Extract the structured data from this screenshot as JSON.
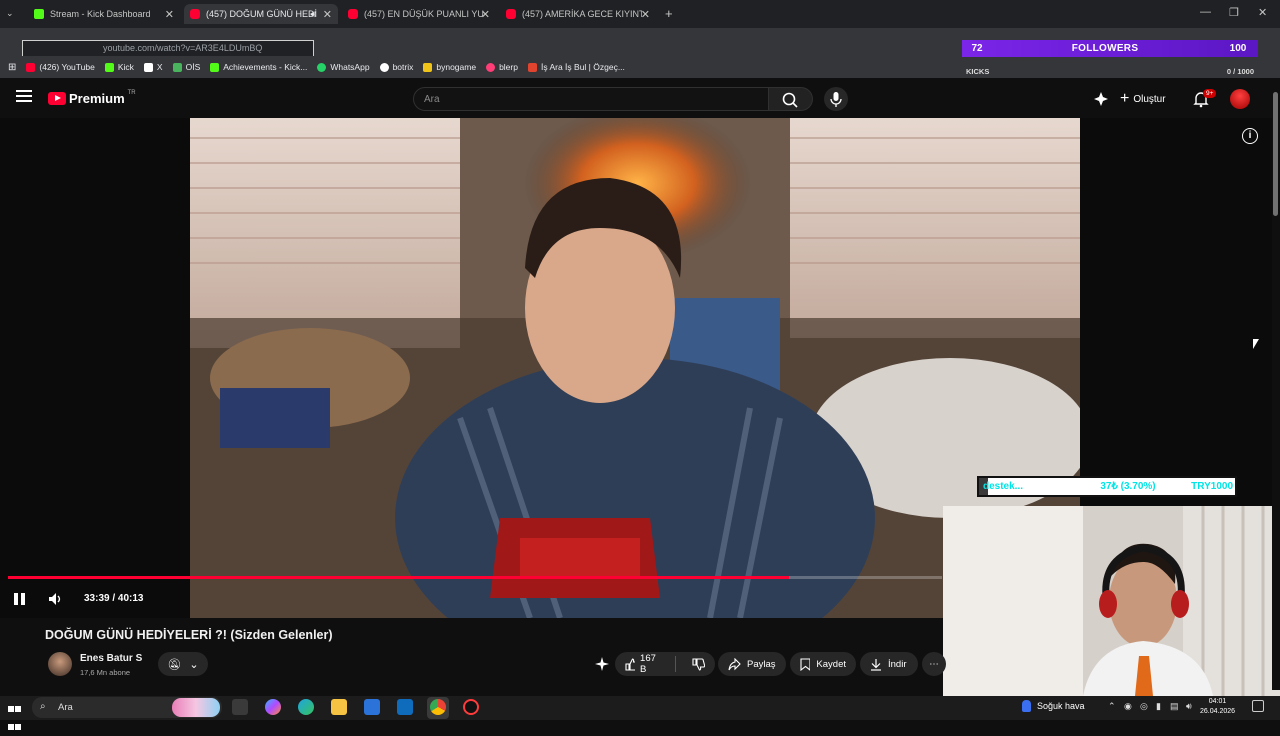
{
  "browser": {
    "tabs": [
      {
        "label": "Stream - Kick Dashboard",
        "favicon": "kick-icon",
        "active": false
      },
      {
        "label": "(457) DOĞUM GÜNÜ HEDİ",
        "favicon": "youtube-icon",
        "active": true
      },
      {
        "label": "(457) EN DÜŞÜK PUANLI YURT",
        "favicon": "youtube-icon",
        "active": false
      },
      {
        "label": "(457) AMERİKA GECE KIYINTISI",
        "favicon": "youtube-icon",
        "active": false
      }
    ],
    "address": "youtube.com/watch?v=AR3E4LDUmBQ",
    "bookmarks": [
      {
        "label": "(426) YouTube",
        "color": "#ff0033"
      },
      {
        "label": "Kick",
        "color": "#53fc18"
      },
      {
        "label": "X",
        "color": "#ffffff"
      },
      {
        "label": "OİS",
        "color": "#49b35d"
      },
      {
        "label": "Achievements - Kick...",
        "color": "#53fc18"
      },
      {
        "label": "WhatsApp",
        "color": "#25d366"
      },
      {
        "label": "botrix",
        "color": "#ffffff"
      },
      {
        "label": "bynogame",
        "color": "#f0c419"
      },
      {
        "label": "blerp",
        "color": "#ff3d77"
      },
      {
        "label": "İş Ara İş Bul | Özgeç...",
        "color": "#e0442f"
      }
    ]
  },
  "overlay": {
    "followers_count": "72",
    "followers_label": "FOLLOWERS",
    "followers_goal": "100",
    "kicks_label": "KICKS",
    "kicks_progress": "0 / 1000",
    "donation_label": "destek...",
    "donation_progress": "37₺ (3.70%)",
    "donation_goal": "TRY1000",
    "donation_fraction": 0.037
  },
  "youtube": {
    "logo_text": "Premium",
    "logo_country": "TR",
    "search_placeholder": "Ara",
    "create_label": "Oluştur",
    "notification_badge": "9+"
  },
  "player": {
    "current_time": "33:39",
    "duration": "40:13",
    "progress_fraction": 0.836,
    "time_display": "33:39 / 40:13"
  },
  "video": {
    "title": "DOĞUM GÜNÜ HEDİYELERİ ?! (Sizden Gelenler)",
    "channel_name": "Enes Batur S",
    "subscribers": "17,6 Mn abone",
    "likes": "167 B",
    "share_label": "Paylaş",
    "save_label": "Kaydet",
    "download_label": "İndir"
  },
  "taskbar": {
    "search_label": "Ara",
    "weather": "Soğuk hava",
    "time": "04:01",
    "date": "26.04.2026"
  },
  "colors": {
    "youtube_red": "#ff0033",
    "kick_green": "#53fc18",
    "overlay_purple": "#7b25e8",
    "donation_cyan": "#00e5e5"
  }
}
